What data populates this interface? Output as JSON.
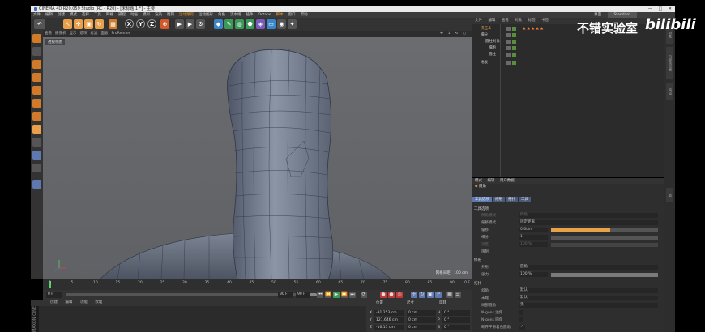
{
  "window": {
    "title": "CINEMA 4D R20.059 Studio (RC - R20) - [未标题 1 *] - 主要",
    "controls": [
      "—",
      "□",
      "✕"
    ]
  },
  "menubar": {
    "items": [
      "文件",
      "编辑",
      "创建",
      "模式",
      "选择",
      "工具",
      "网格",
      "捕捉",
      "动画",
      "模拟",
      "渲染",
      "雕刻",
      "运动跟踪",
      "运动图形",
      "角色",
      "流水线",
      "插件",
      "Octane",
      "脚本",
      "窗口",
      "帮助"
    ],
    "layout_label": "界面",
    "layout_value": "Standard"
  },
  "viewport": {
    "menu": [
      "查看",
      "摄像机",
      "显示",
      "选项",
      "过滤",
      "面板",
      "ProRender"
    ],
    "label": "透视视图",
    "grid_distance": "网格间距：100 cm"
  },
  "timeline": {
    "ticks": [
      "0",
      "5",
      "10",
      "15",
      "20",
      "25",
      "30",
      "35",
      "40",
      "45",
      "50",
      "55",
      "60",
      "65",
      "70",
      "75",
      "80",
      "85",
      "90"
    ],
    "frames": "0 F",
    "start": "0 F",
    "current": "0 F",
    "end": "90 F",
    "end2": "90 F"
  },
  "material": {
    "menu": [
      "创建",
      "编辑",
      "功能",
      "纹理"
    ],
    "logo": "MAXON CINEMA 4D"
  },
  "coords": {
    "headers": [
      "位置",
      "尺寸",
      "旋转"
    ],
    "rows": [
      {
        "axis": "X",
        "pos": "-91.253 cm",
        "size": "0 cm",
        "rotl": "H",
        "rot": "0 °"
      },
      {
        "axis": "Y",
        "pos": "121.646 cm",
        "size": "0 cm",
        "rotl": "P",
        "rot": "0 °"
      },
      {
        "axis": "Z",
        "pos": "-16.13 cm",
        "size": "0 cm",
        "rotl": "B",
        "rot": "0 °"
      }
    ]
  },
  "object_manager": {
    "tabs": [
      "文件",
      "编辑",
      "查看",
      "对象",
      "标签",
      "书签"
    ],
    "objects": [
      {
        "name": "挤压.1",
        "selected": true
      },
      {
        "name": "细分",
        "selected": false
      },
      {
        "name": "圆柱对象",
        "selected": false
      },
      {
        "name": "细胞",
        "selected": false
      },
      {
        "name": "圆柱",
        "selected": false
      },
      {
        "name": "地板",
        "selected": false
      }
    ]
  },
  "attributes": {
    "tabs": [
      "模式",
      "编辑",
      "用户数据"
    ],
    "title": "倒角",
    "subtabs": [
      "工具选项",
      "修形",
      "拓扑",
      "工具"
    ],
    "section_tool": "工具选项",
    "rows": [
      {
        "label": "倒角模式",
        "value": "倒角",
        "dim": true
      },
      {
        "label": "偏移模式",
        "value": "固定距离",
        "dim": false
      },
      {
        "label": "偏移",
        "value": "0.6cm",
        "dim": false
      },
      {
        "label": "细分",
        "value": "1",
        "dim": false
      },
      {
        "label": "深度",
        "value": "100 %",
        "dim": true
      },
      {
        "label": "限制",
        "value": "",
        "dim": false
      }
    ],
    "offset_fraction": 0.55,
    "section_shape": "修形",
    "shape_rows": [
      {
        "label": "外形",
        "value": "圆角"
      },
      {
        "label": "张力",
        "value": "100 %"
      }
    ],
    "section_topo": "拓扑",
    "topo_rows": [
      {
        "label": "斜角",
        "value": "默认"
      },
      {
        "label": "末端",
        "value": "默认"
      },
      {
        "label": "局部圆角",
        "value": "无"
      },
      {
        "label": "N-gons 边角",
        "value": ""
      },
      {
        "label": "N-gons 圆角",
        "value": ""
      },
      {
        "label": "断开平滑着色圆角",
        "value": "✓"
      }
    ]
  },
  "side_tabs": [
    "对象",
    "内容浏览器",
    "构造",
    "层"
  ],
  "watermark": {
    "text": "不错实验室",
    "logo": "bilibili"
  }
}
